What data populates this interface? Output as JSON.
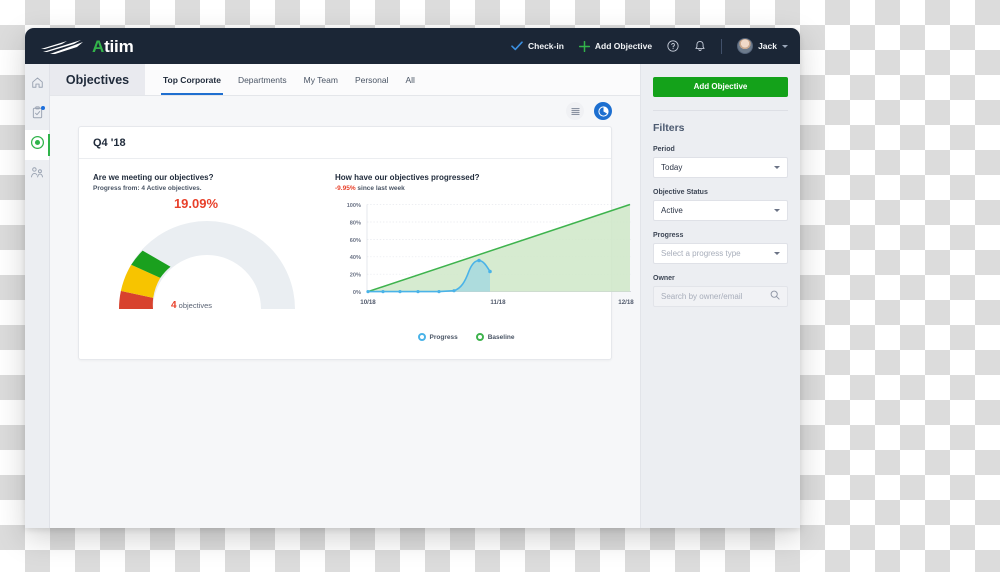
{
  "topbar": {
    "logo_text_a": "A",
    "logo_text_rest": "tiim",
    "logo_icon": "swoosh-lines-icon",
    "checkin_label": "Check-in",
    "checkin_icon": "checkmark-icon",
    "add_objective_label": "Add Objective",
    "add_objective_icon": "plus-icon",
    "help_icon": "question-circle-icon",
    "notifications_icon": "bell-icon",
    "avatar_icon": "user-avatar",
    "user_name": "Jack",
    "user_caret_icon": "chevron-down-icon"
  },
  "rail": {
    "items": [
      {
        "name": "home",
        "icon": "home-icon",
        "active": false,
        "badge": false
      },
      {
        "name": "checkins",
        "icon": "clipboard-check-icon",
        "active": false,
        "badge": true
      },
      {
        "name": "objectives",
        "icon": "target-icon",
        "active": true,
        "badge": false
      },
      {
        "name": "people",
        "icon": "people-icon",
        "active": false,
        "badge": false
      }
    ]
  },
  "header": {
    "page_title": "Objectives",
    "tabs": [
      {
        "label": "Top Corporate",
        "active": true
      },
      {
        "label": "Departments",
        "active": false
      },
      {
        "label": "My Team",
        "active": false
      },
      {
        "label": "Personal",
        "active": false
      },
      {
        "label": "All",
        "active": false
      }
    ]
  },
  "toolbar": {
    "list_view_icon": "list-view-icon",
    "chart_view_icon": "pie-chart-icon",
    "active_view": "chart"
  },
  "card": {
    "title": "Q4 '18"
  },
  "chart_data": [
    {
      "type": "pie",
      "title": "Are we meeting our objectives?",
      "subtitle": "Progress from: 4 Active objectives.",
      "value_label": "19.09%",
      "value": 19.09,
      "count_number": "4",
      "count_label": "objectives",
      "gauge_segments": [
        {
          "name": "red",
          "color": "#d8422e",
          "start_deg": 0,
          "end_deg": 13
        },
        {
          "name": "yellow",
          "color": "#f7c400",
          "start_deg": 13,
          "end_deg": 29
        },
        {
          "name": "green",
          "color": "#1aa01e",
          "start_deg": 29,
          "end_deg": 43
        },
        {
          "name": "empty",
          "color": "#eaeef2",
          "start_deg": 43,
          "end_deg": 180
        }
      ]
    },
    {
      "type": "area",
      "title": "How have our objectives progressed?",
      "subtitle_value": "-9.95%",
      "subtitle_rest": " since last week",
      "ylabel": "",
      "xlabel": "",
      "ylim": [
        0,
        100
      ],
      "yticks": [
        "0%",
        "20%",
        "40%",
        "60%",
        "80%",
        "100%"
      ],
      "xticks": [
        "10/18",
        "11/18",
        "12/18"
      ],
      "grid": true,
      "legend_position": "bottom-center",
      "series": [
        {
          "name": "Progress",
          "color": "#4ab3e8",
          "x": [
            0,
            4,
            8,
            12,
            17,
            22,
            26,
            29,
            31,
            33,
            35,
            37,
            39
          ],
          "values": [
            0,
            0,
            0,
            0,
            0,
            0,
            0,
            1,
            4,
            12,
            21,
            23,
            13
          ]
        },
        {
          "name": "Baseline",
          "color": "#3eb34d",
          "x": [
            0,
            100
          ],
          "values": [
            0,
            100
          ]
        }
      ]
    }
  ],
  "filters": {
    "add_objective_label": "Add Objective",
    "title": "Filters",
    "period_label": "Period",
    "period_value": "Today",
    "status_label": "Objective Status",
    "status_value": "Active",
    "progress_label": "Progress",
    "progress_placeholder": "Select a progress type",
    "owner_label": "Owner",
    "owner_placeholder": "Search by owner/email",
    "search_icon": "magnifier-icon"
  }
}
